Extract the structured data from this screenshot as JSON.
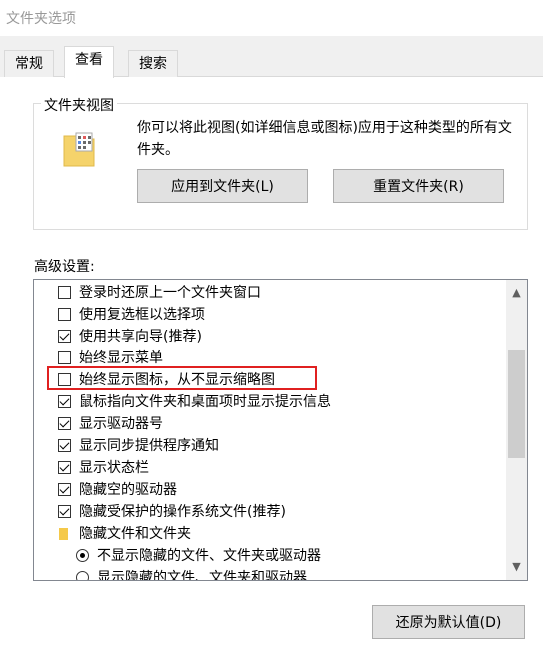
{
  "window": {
    "title": "文件夹选项"
  },
  "tabs": [
    {
      "label": "常规",
      "active": false
    },
    {
      "label": "查看",
      "active": true
    },
    {
      "label": "搜索",
      "active": false
    }
  ],
  "folder_views": {
    "group_title": "文件夹视图",
    "description": "你可以将此视图(如详细信息或图标)应用于这种类型的所有文件夹。",
    "apply_button": "应用到文件夹(L)",
    "reset_button": "重置文件夹(R)"
  },
  "advanced": {
    "label": "高级设置:",
    "items": [
      {
        "type": "checkbox",
        "label": "登录时还原上一个文件夹窗口",
        "checked": false
      },
      {
        "type": "checkbox",
        "label": "使用复选框以选择项",
        "checked": false
      },
      {
        "type": "checkbox",
        "label": "使用共享向导(推荐)",
        "checked": true
      },
      {
        "type": "checkbox",
        "label": "始终显示菜单",
        "checked": false
      },
      {
        "type": "checkbox",
        "label": "始终显示图标，从不显示缩略图",
        "checked": false
      },
      {
        "type": "checkbox",
        "label": "鼠标指向文件夹和桌面项时显示提示信息",
        "checked": true
      },
      {
        "type": "checkbox",
        "label": "显示驱动器号",
        "checked": true
      },
      {
        "type": "checkbox",
        "label": "显示同步提供程序通知",
        "checked": true
      },
      {
        "type": "checkbox",
        "label": "显示状态栏",
        "checked": true
      },
      {
        "type": "checkbox",
        "label": "隐藏空的驱动器",
        "checked": true
      },
      {
        "type": "checkbox",
        "label": "隐藏受保护的操作系统文件(推荐)",
        "checked": true
      },
      {
        "type": "folder",
        "label": "隐藏文件和文件夹"
      },
      {
        "type": "radio",
        "label": "不显示隐藏的文件、文件夹或驱动器",
        "checked": true
      },
      {
        "type": "radio",
        "label": "显示隐藏的文件、文件夹和驱动器",
        "checked": false
      }
    ]
  },
  "restore_button": "还原为默认值(D)",
  "colors": {
    "highlight": "#e02020",
    "folder": "#f5c94a"
  }
}
